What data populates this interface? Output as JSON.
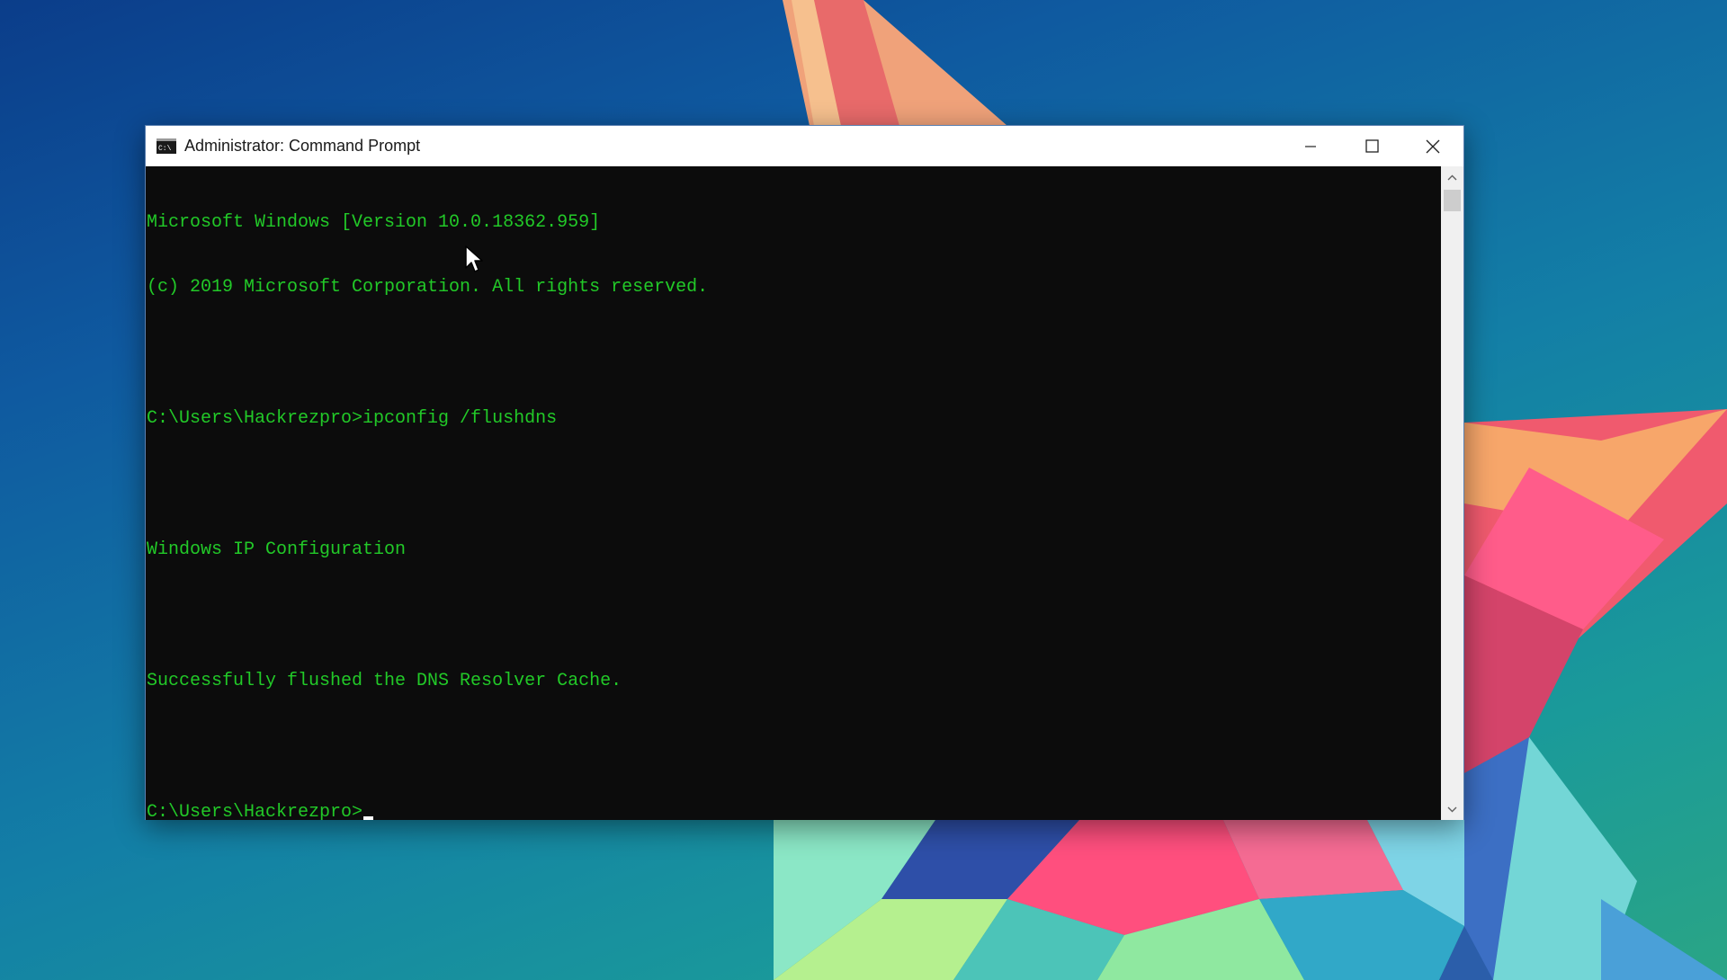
{
  "window": {
    "title": "Administrator: Command Prompt",
    "icon": "cmd-icon"
  },
  "titlebar_buttons": {
    "minimize_icon": "minimize-icon",
    "maximize_icon": "maximize-icon",
    "close_icon": "close-icon"
  },
  "console": {
    "lines": [
      "Microsoft Windows [Version 10.0.18362.959]",
      "(c) 2019 Microsoft Corporation. All rights reserved.",
      "",
      "C:\\Users\\Hackrezpro>ipconfig /flushdns",
      "",
      "Windows IP Configuration",
      "",
      "Successfully flushed the DNS Resolver Cache.",
      "",
      "C:\\Users\\Hackrezpro>"
    ],
    "text_color": "#22c928",
    "background_color": "#0c0c0c"
  },
  "scrollbar": {
    "up_icon": "chevron-up-icon",
    "down_icon": "chevron-down-icon"
  },
  "colors": {
    "desktop_gradient_start": "#0b3d8a",
    "desktop_gradient_end": "#2aa585",
    "titlebar": "#ffffff"
  }
}
